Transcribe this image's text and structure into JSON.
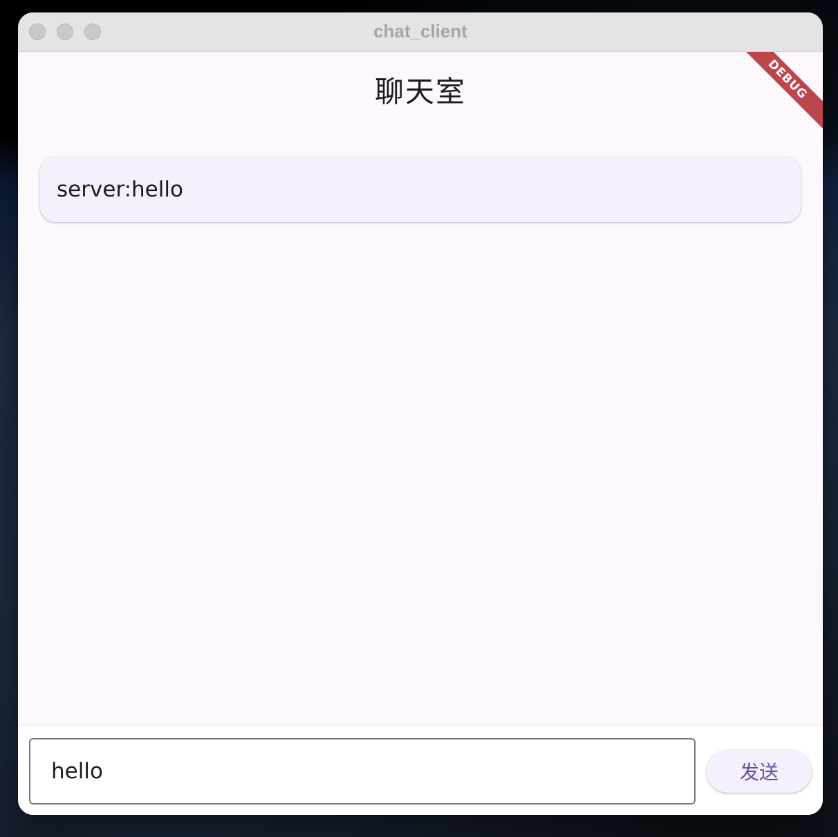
{
  "window": {
    "title": "chat_client"
  },
  "app": {
    "title": "聊天室",
    "debug_banner": "DEBUG"
  },
  "messages": [
    {
      "text": "server:hello"
    }
  ],
  "composer": {
    "input_value": "hello",
    "send_label": "发送"
  },
  "colors": {
    "background": "#fdf7fe",
    "card": "#f5f0fb",
    "accent": "#6750a4",
    "debug_ribbon": "#b3262d",
    "titlebar": "#e4e4e6"
  }
}
